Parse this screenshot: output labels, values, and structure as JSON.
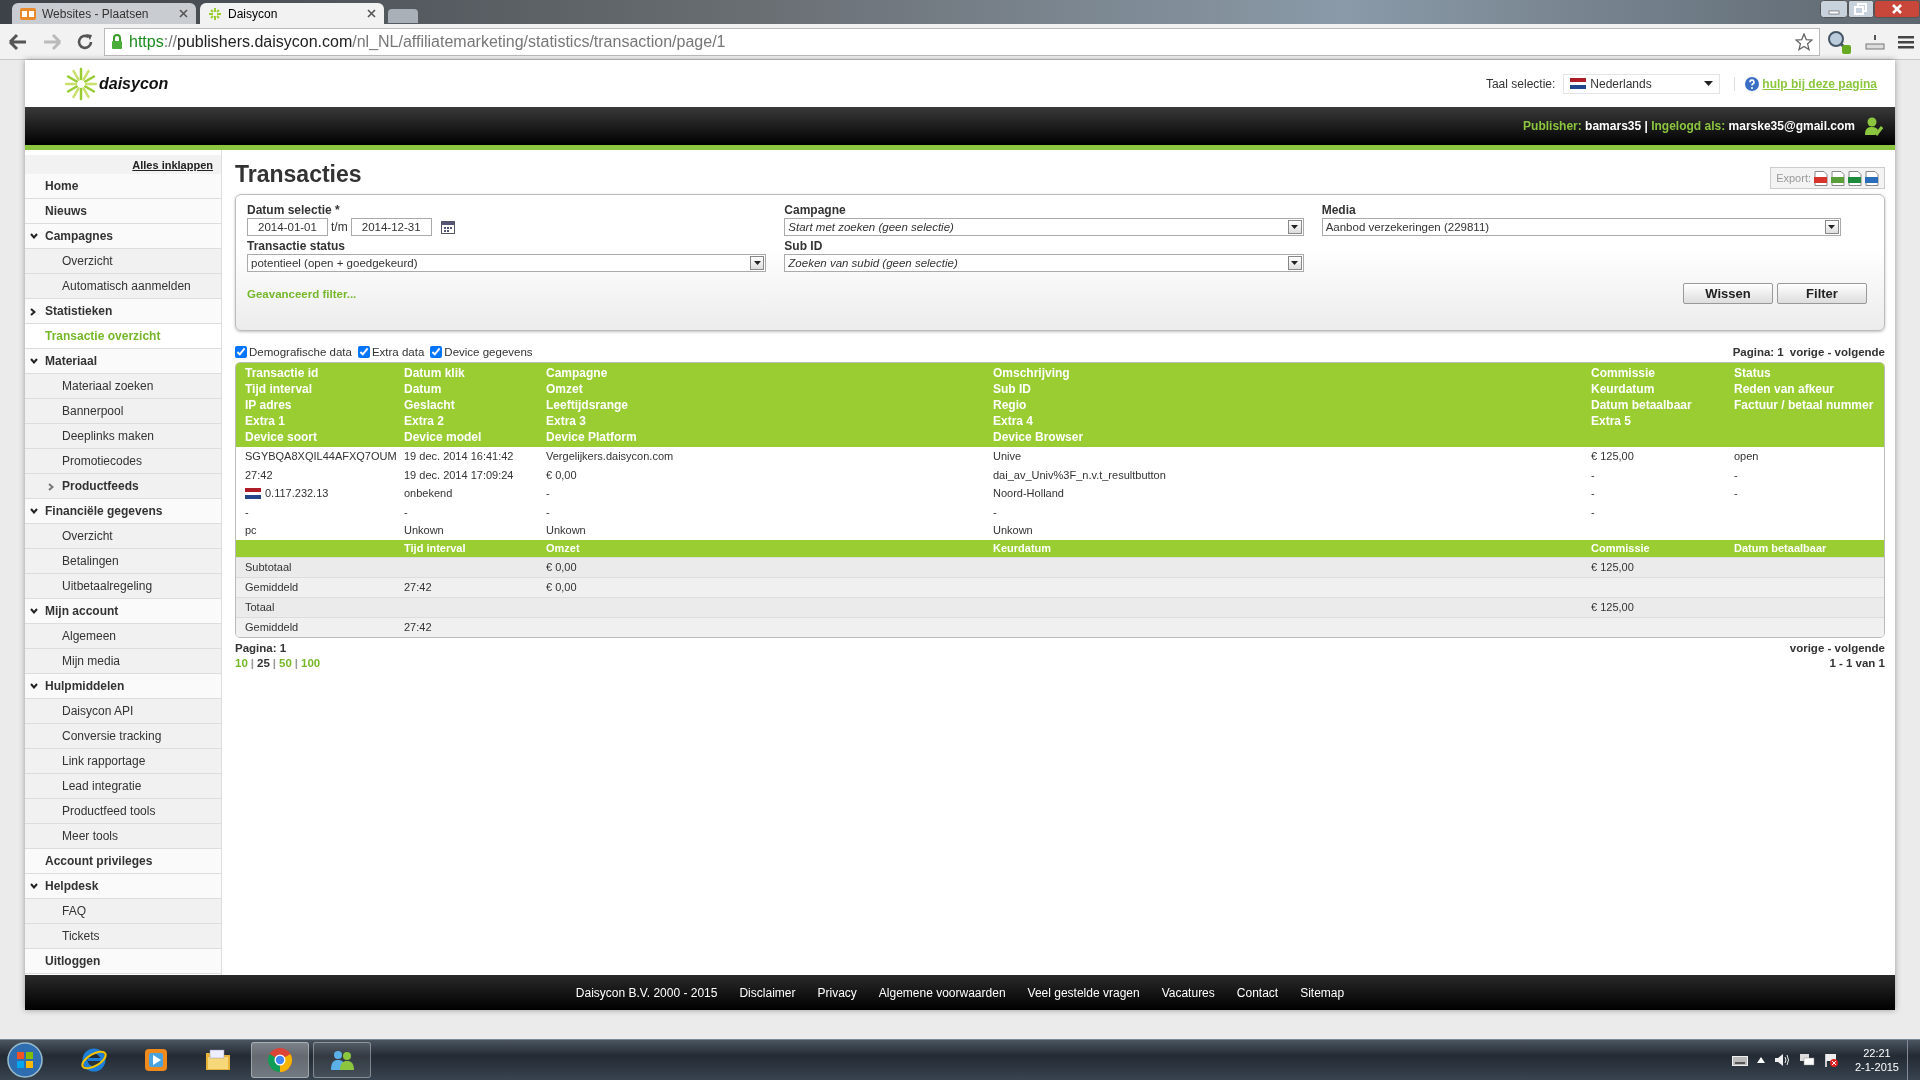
{
  "browser": {
    "tabs": [
      {
        "title": "Websites - Plaatsen",
        "selected": false
      },
      {
        "title": "Daisycon",
        "selected": true
      }
    ],
    "url": [
      {
        "text": "https",
        "kind": "scheme"
      },
      {
        "text": "://",
        "kind": "plain"
      },
      {
        "text": "publishers.daisycon.com",
        "kind": "host"
      },
      {
        "text": "/nl_NL/affiliatemarketing/statistics/transaction/page/1",
        "kind": "plain"
      }
    ]
  },
  "header": {
    "logo": "daisycon",
    "language_label": "Taal selectie:",
    "language": "Nederlands",
    "help_link": "hulp bij deze pagina"
  },
  "user": {
    "publisher_label": "Publisher:",
    "publisher": "bamars35",
    "separator": "|",
    "login_label": "Ingelogd als:",
    "email": "marske35@gmail.com"
  },
  "sidebar": {
    "collapse_all": "Alles inklappen",
    "items": [
      {
        "label": "Home",
        "selected": false
      },
      {
        "label": "Nieuws",
        "selected": false
      },
      {
        "label": "Campagnes",
        "selected": false,
        "expanded": true,
        "children": [
          {
            "label": "Overzicht",
            "selected": false
          },
          {
            "label": "Automatisch aanmelden",
            "selected": false
          }
        ]
      },
      {
        "label": "Statistieken",
        "selected": false,
        "expanded": false
      },
      {
        "label": "Transactie overzicht",
        "selected": true
      },
      {
        "label": "Materiaal",
        "selected": false,
        "expanded": true,
        "children": [
          {
            "label": "Materiaal zoeken",
            "selected": false
          },
          {
            "label": "Bannerpool",
            "selected": false
          },
          {
            "label": "Deeplinks maken",
            "selected": false
          },
          {
            "label": "Promotiecodes",
            "selected": false
          },
          {
            "label": "Productfeeds",
            "selected": false,
            "expanded": false
          }
        ]
      },
      {
        "label": "Financiële gegevens",
        "selected": false,
        "expanded": true,
        "children": [
          {
            "label": "Overzicht",
            "selected": false
          },
          {
            "label": "Betalingen",
            "selected": false
          },
          {
            "label": "Uitbetaalregeling",
            "selected": false
          }
        ]
      },
      {
        "label": "Mijn account",
        "selected": false,
        "expanded": true,
        "children": [
          {
            "label": "Algemeen",
            "selected": false
          },
          {
            "label": "Mijn media",
            "selected": false
          }
        ]
      },
      {
        "label": "Hulpmiddelen",
        "selected": false,
        "expanded": true,
        "children": [
          {
            "label": "Daisycon API",
            "selected": false
          },
          {
            "label": "Conversie tracking",
            "selected": false
          },
          {
            "label": "Link rapportage",
            "selected": false
          },
          {
            "label": "Lead integratie",
            "selected": false
          },
          {
            "label": "Productfeed tools",
            "selected": false
          },
          {
            "label": "Meer tools",
            "selected": false
          }
        ]
      },
      {
        "label": "Account privileges",
        "selected": false
      },
      {
        "label": "Helpdesk",
        "selected": false,
        "expanded": true,
        "children": [
          {
            "label": "FAQ",
            "selected": false
          },
          {
            "label": "Tickets",
            "selected": false
          }
        ]
      },
      {
        "label": "Uitloggen",
        "selected": false
      }
    ]
  },
  "page_title": "Transacties",
  "export": {
    "label": "Export:",
    "formats": [
      {
        "kind": "csv"
      },
      {
        "kind": "xml"
      },
      {
        "kind": "xls"
      },
      {
        "kind": "json"
      }
    ]
  },
  "filters": {
    "date": {
      "label": "Datum selectie *",
      "from": "2014-01-01",
      "separator": "t/m",
      "to": "2014-12-31"
    },
    "campaign": {
      "label": "Campagne",
      "placeholder": "Start met zoeken (geen selectie)"
    },
    "media": {
      "label": "Media",
      "value": "Aanbod verzekeringen (229811)"
    },
    "status": {
      "label": "Transactie status",
      "value": "potentieel (open + goedgekeurd)"
    },
    "sub_id": {
      "label": "Sub ID",
      "placeholder": "Zoeken van subid (geen selectie)"
    },
    "advanced_link": "Geavanceerd filter...",
    "buttons": [
      "Wissen",
      "Filter"
    ]
  },
  "options": [
    {
      "label": "Demografische data",
      "checked": true
    },
    {
      "label": "Extra data",
      "checked": true
    },
    {
      "label": "Device gegevens",
      "checked": true
    }
  ],
  "pager_top": {
    "page": "Pagina: 1",
    "nav": "vorige - volgende"
  },
  "table": {
    "columns": [
      {
        "headings": [
          "Transactie id",
          "Tijd interval",
          "IP adres",
          "Extra 1",
          "Device soort"
        ],
        "cells": [
          "SGYBQA8XQIL44AFXQ7OUM",
          "27:42",
          {
            "kind": "country",
            "text": "0.117.232.13"
          },
          "-",
          "pc"
        ]
      },
      {
        "headings": [
          "Datum klik",
          "Datum",
          "Geslacht",
          "Extra 2",
          "Device model"
        ],
        "cells": [
          "19 dec. 2014 16:41:42",
          "19 dec. 2014 17:09:24",
          "onbekend",
          "-",
          "Unkown"
        ],
        "summary_heading": "Tijd interval"
      },
      {
        "headings": [
          "Campagne",
          "Omzet",
          "Leeftijdsrange",
          "Extra 3",
          "Device Platform"
        ],
        "cells": [
          "Vergelijkers.daisycon.com",
          "€ 0,00",
          "-",
          "-",
          "Unkown"
        ],
        "summary_heading": "Omzet"
      },
      {
        "headings": [
          "Omschrijving",
          "Sub ID",
          "Regio",
          "Extra 4",
          "Device Browser"
        ],
        "cells": [
          "Unive",
          "dai_av_Univ%3F_n.v.t_resultbutton",
          "Noord-Holland",
          "-",
          "Unkown"
        ],
        "summary_heading": "Keurdatum"
      },
      {
        "headings": [
          "Commissie",
          "Keurdatum",
          "Datum betaalbaar",
          "Extra 5"
        ],
        "cells": [
          "€ 125,00",
          "-",
          "-",
          "-"
        ],
        "summary_heading": "Commissie"
      },
      {
        "headings": [
          "Status",
          "Reden van afkeur",
          "Factuur / betaal nummer"
        ],
        "cells": [
          "open",
          "-",
          "-"
        ],
        "summary_heading": "Datum betaalbaar"
      }
    ],
    "summary_rows": [
      {
        "cells": [
          "Subtotaal",
          null,
          "€ 0,00",
          null,
          "€ 125,00",
          null
        ]
      },
      {
        "cells": [
          "Gemiddeld",
          "27:42",
          "€ 0,00",
          null,
          null,
          null
        ]
      },
      {
        "cells": [
          "Totaal",
          null,
          null,
          null,
          "€ 125,00",
          null
        ]
      },
      {
        "cells": [
          "Gemiddeld",
          "27:42",
          null,
          null,
          null,
          null
        ]
      }
    ]
  },
  "pager_bottom": {
    "page": "Pagina: 1",
    "sizes": [
      {
        "label": "10",
        "selected": false
      },
      {
        "label": "25",
        "selected": true
      },
      {
        "label": "50",
        "selected": false
      },
      {
        "label": "100",
        "selected": false
      }
    ],
    "separator": "|",
    "nav": "vorige - volgende",
    "range": "1 - 1 van 1"
  },
  "footer": {
    "copyright": "Daisycon B.V. 2000 - 2015",
    "links": [
      "Disclaimer",
      "Privacy",
      "Algemene voorwaarden",
      "Veel gestelde vragen",
      "Vacatures",
      "Contact",
      "Sitemap"
    ]
  },
  "taskbar": {
    "apps": [
      {
        "kind": "ie",
        "running": false,
        "selected": false
      },
      {
        "kind": "media",
        "running": false,
        "selected": false
      },
      {
        "kind": "folder",
        "running": false,
        "selected": false
      },
      {
        "kind": "chrome",
        "running": true,
        "selected": true
      },
      {
        "kind": "people",
        "running": true,
        "selected": false
      }
    ],
    "time": "22:21",
    "date": "2-1-2015"
  }
}
